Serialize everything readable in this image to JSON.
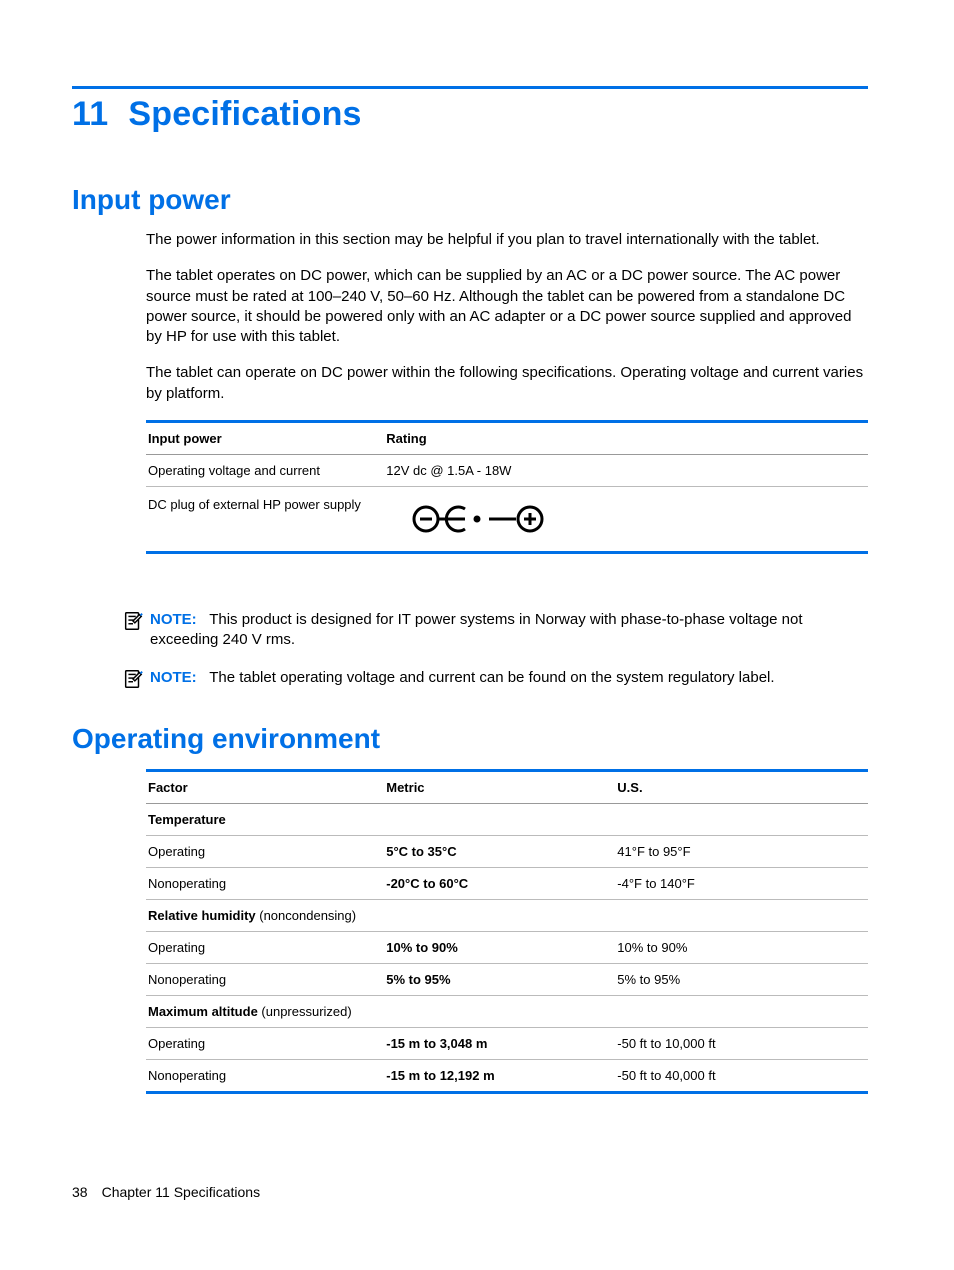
{
  "chapter": {
    "number": "11",
    "title": "Specifications"
  },
  "section1": {
    "title": "Input power",
    "p1": "The power information in this section may be helpful if you plan to travel internationally with the tablet.",
    "p2": "The tablet operates on DC power, which can be supplied by an AC or a DC power source. The AC power source must be rated at 100–240 V, 50–60 Hz. Although the tablet can be powered from a standalone DC power source, it should be powered only with an AC adapter or a DC power source supplied and approved by HP for use with this tablet.",
    "p3": "The tablet can operate on DC power within the following specifications. Operating voltage and current varies by platform.",
    "table": {
      "head": {
        "c1": "Input power",
        "c2": "Rating"
      },
      "row1": {
        "c1": "Operating voltage and current",
        "c2": "12V dc @ 1.5A - 18W"
      },
      "row2": {
        "c1": "DC plug of external HP power supply"
      }
    },
    "note1": {
      "label": "NOTE:",
      "text": "This product is designed for IT power systems in Norway with phase-to-phase voltage not exceeding 240 V rms."
    },
    "note2": {
      "label": "NOTE:",
      "text": "The tablet operating voltage and current can be found on the system regulatory label."
    }
  },
  "section2": {
    "title": "Operating environment",
    "table": {
      "head": {
        "c1": "Factor",
        "c2": "Metric",
        "c3": "U.S."
      },
      "r_temp_hdr": {
        "label": "Temperature"
      },
      "r_temp_op": {
        "c1": "Operating",
        "c2": "5°C to 35°C",
        "c3": "41°F to 95°F"
      },
      "r_temp_nop": {
        "c1": "Nonoperating",
        "c2": "-20°C to 60°C",
        "c3": "-4°F to 140°F"
      },
      "r_hum_hdr": {
        "label_bold": "Relative humidity",
        "label_rest": " (noncondensing)"
      },
      "r_hum_op": {
        "c1": "Operating",
        "c2": "10% to 90%",
        "c3": "10% to 90%"
      },
      "r_hum_nop": {
        "c1": "Nonoperating",
        "c2": "5% to 95%",
        "c3": "5% to 95%"
      },
      "r_alt_hdr": {
        "label_bold": "Maximum altitude",
        "label_rest": " (unpressurized)"
      },
      "r_alt_op": {
        "c1": "Operating",
        "c2": "-15 m to 3,048 m",
        "c3": "-50 ft to 10,000 ft"
      },
      "r_alt_nop": {
        "c1": "Nonoperating",
        "c2": "-15 m to 12,192 m",
        "c3": "-50 ft to 40,000 ft"
      }
    }
  },
  "footer": {
    "page_number": "38",
    "chapter_label": "Chapter 11   Specifications"
  }
}
